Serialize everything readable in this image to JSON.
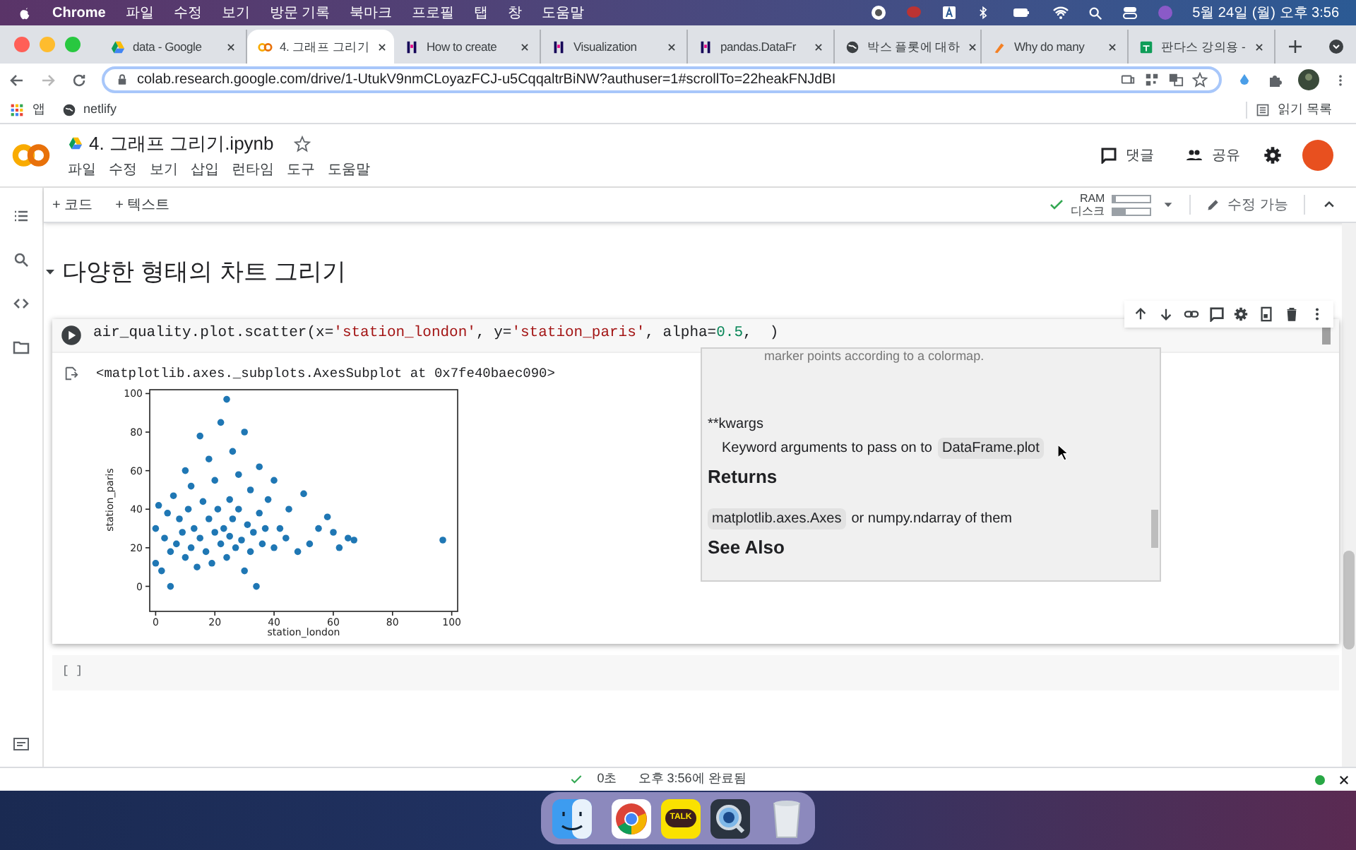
{
  "menubar": {
    "app": "Chrome",
    "items": [
      "파일",
      "수정",
      "보기",
      "방문 기록",
      "북마크",
      "프로필",
      "탭",
      "창",
      "도움말"
    ],
    "clock": "5월 24일 (월) 오후 3:56"
  },
  "tabs": [
    {
      "title": "data - Google",
      "selected": false
    },
    {
      "title": "4. 그래프 그리기",
      "selected": true
    },
    {
      "title": "How to create",
      "selected": false
    },
    {
      "title": "Visualization",
      "selected": false
    },
    {
      "title": "pandas.DataFr",
      "selected": false
    },
    {
      "title": "박스 플롯에 대하",
      "selected": false
    },
    {
      "title": "Why do many",
      "selected": false
    },
    {
      "title": "판다스 강의용 -",
      "selected": false
    }
  ],
  "address_bar": {
    "url": "colab.research.google.com/drive/1-UtukV9nmCLoyazFCJ-u5CqqaltrBiNW?authuser=1#scrollTo=22heakFNJdBI"
  },
  "bookmarks": [
    "앱",
    "netlify"
  ],
  "reading_list": "읽기 목록",
  "notebook": {
    "title": "4. 그래프 그리기.ipynb",
    "menu": [
      "파일",
      "수정",
      "보기",
      "삽입",
      "런타임",
      "도구",
      "도움말"
    ],
    "comment": "댓글",
    "share": "공유"
  },
  "toolbar": {
    "add_code": "+ 코드",
    "add_text": "+ 텍스트",
    "ram_label": "RAM",
    "ram": {
      "level": 0.05
    },
    "disk_label": "디스크",
    "disk": {
      "level": 0.35
    },
    "edit_mode": "수정 가능"
  },
  "section": {
    "title": "다양한 형태의 차트 그리기",
    "expanded": true
  },
  "cells": [
    {
      "kind": "code",
      "code": [
        {
          "kind": "plain",
          "text": "air_quality.plot.scatter(x="
        },
        {
          "kind": "string",
          "text": "'station_london'"
        },
        {
          "kind": "plain",
          "text": ", y="
        },
        {
          "kind": "string",
          "text": "'station_paris'"
        },
        {
          "kind": "plain",
          "text": ", alpha="
        },
        {
          "kind": "number",
          "text": "0.5"
        },
        {
          "kind": "plain",
          "text": ",  )"
        }
      ],
      "output_text": "<matplotlib.axes._subplots.AxesSubplot at 0x7fe40baec090>",
      "chart_data": {
        "type": "scatter",
        "xlabel": "station_london",
        "ylabel": "station_paris",
        "xlim": [
          -2,
          102
        ],
        "ylim": [
          -13,
          102
        ],
        "xticks": [
          0,
          20,
          40,
          60,
          80,
          100
        ],
        "yticks": [
          0,
          20,
          40,
          60,
          80,
          100
        ],
        "x": [
          0,
          0,
          1,
          2,
          3,
          4,
          5,
          5,
          6,
          7,
          8,
          9,
          10,
          10,
          11,
          12,
          12,
          13,
          14,
          15,
          15,
          16,
          17,
          18,
          18,
          19,
          20,
          20,
          21,
          22,
          22,
          23,
          24,
          24,
          25,
          25,
          26,
          26,
          27,
          28,
          28,
          29,
          30,
          30,
          31,
          32,
          32,
          33,
          34,
          35,
          35,
          36,
          37,
          38,
          40,
          40,
          42,
          44,
          45,
          48,
          50,
          52,
          55,
          58,
          60,
          62,
          65,
          67,
          97
        ],
        "series": [
          {
            "color": "#1f77b4",
            "values": [
              12,
              30,
              42,
              8,
              25,
              38,
              0,
              18,
              47,
              22,
              35,
              28,
              60,
              15,
              40,
              20,
              52,
              30,
              10,
              78,
              25,
              44,
              18,
              35,
              66,
              12,
              28,
              55,
              40,
              22,
              85,
              30,
              97,
              15,
              45,
              26,
              70,
              35,
              20,
              58,
              40,
              24,
              80,
              8,
              32,
              18,
              50,
              28,
              0,
              38,
              62,
              22,
              30,
              45,
              20,
              55,
              30,
              25,
              40,
              18,
              48,
              22,
              30,
              36,
              28,
              20,
              25,
              24,
              24
            ]
          }
        ]
      },
      "tooltip": [
        {
          "kind": "text",
          "text": "marker points according to a colormap."
        },
        {
          "kind": "param",
          "text": "**kwargs"
        },
        {
          "kind": "desc",
          "text": "Keyword arguments to pass on to",
          "code": "DataFrame.plot"
        },
        {
          "kind": "heading",
          "text": "Returns"
        },
        {
          "kind": "return",
          "code": "matplotlib.axes.Axes",
          "text": "or numpy.ndarray of them"
        },
        {
          "kind": "heading",
          "text": "See Also"
        }
      ]
    },
    {
      "kind": "empty",
      "prompt": "[ ]"
    }
  ],
  "status_bar": {
    "duration": "0초",
    "completed": "오후 3:56에 완료됨"
  },
  "dock": [
    {
      "kind": "finder"
    },
    {
      "kind": "chrome"
    },
    {
      "kind": "kakaotalk",
      "label": "TALK"
    },
    {
      "kind": "quicktime"
    },
    {
      "kind": "trash"
    }
  ]
}
